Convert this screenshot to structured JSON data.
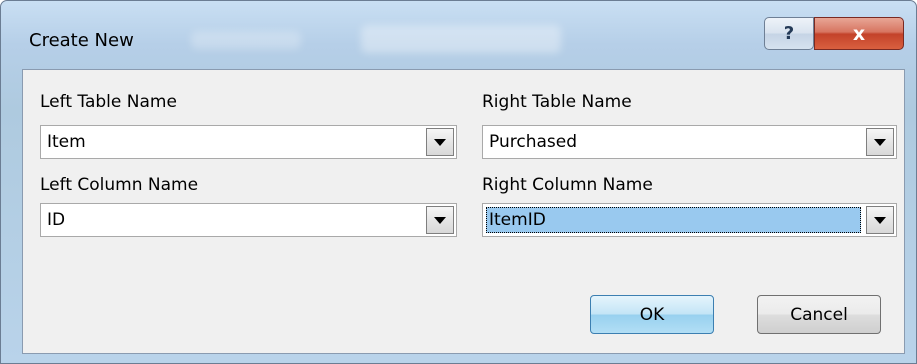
{
  "window": {
    "title": "Create New",
    "help_glyph": "?",
    "close_glyph": "x"
  },
  "form": {
    "left_table": {
      "label": "Left Table Name",
      "value": "Item"
    },
    "right_table": {
      "label": "Right Table Name",
      "value": "Purchased"
    },
    "left_column": {
      "label": "Left Column Name",
      "value": "ID"
    },
    "right_column": {
      "label": "Right Column Name",
      "value": "ItemID"
    }
  },
  "buttons": {
    "ok": "OK",
    "cancel": "Cancel"
  },
  "colors": {
    "selection": "#99c9ef",
    "close_button": "#c3422a",
    "ok_button": "#98d1ef"
  },
  "icons": {
    "help": "help-icon",
    "close": "close-icon",
    "dropdown": "chevron-down-icon"
  }
}
